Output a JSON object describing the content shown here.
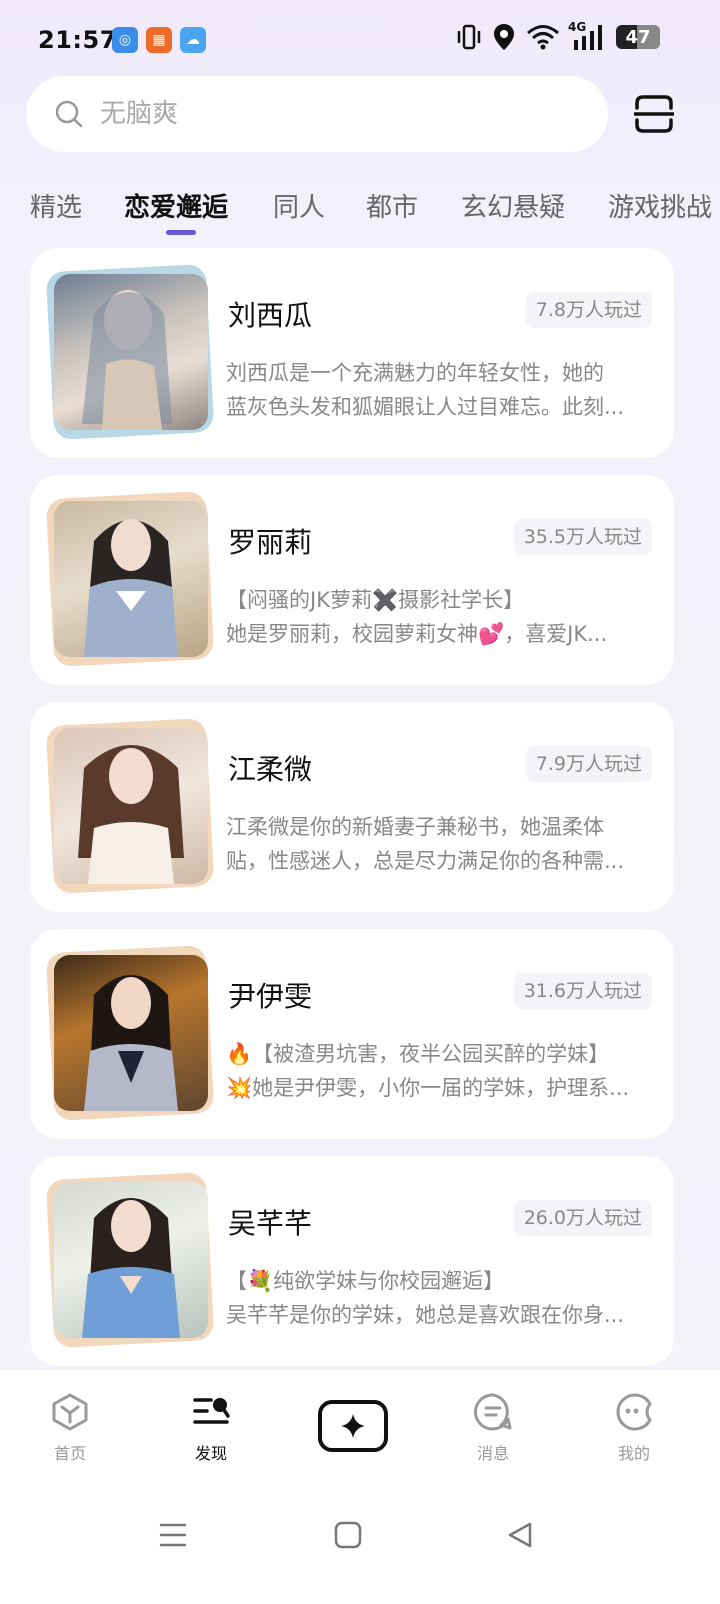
{
  "status_bar": {
    "time": "21:57",
    "network": "4G",
    "battery": "47",
    "notification_icons": [
      "app-icon",
      "grid-app-icon",
      "weather-icon"
    ]
  },
  "search": {
    "placeholder": "无脑爽"
  },
  "tabs": [
    {
      "label": "精选",
      "active": false
    },
    {
      "label": "恋爱邂逅",
      "active": true
    },
    {
      "label": "同人",
      "active": false
    },
    {
      "label": "都市",
      "active": false
    },
    {
      "label": "玄幻悬疑",
      "active": false
    },
    {
      "label": "游戏挑战",
      "active": false
    }
  ],
  "cards": [
    {
      "name": "刘西瓜",
      "plays": "7.8万人玩过",
      "line1": "刘西瓜是一个充满魅力的年轻女性，她的",
      "line2": "蓝灰色头发和狐媚眼让人过目难忘。此刻...",
      "frame_color": "#b9d8e6"
    },
    {
      "name": "罗丽莉",
      "plays": "35.5万人玩过",
      "line1": "【闷骚的JK萝莉✖️摄影社学长】",
      "line2": "她是罗丽莉，校园萝莉女神💕，喜爱JK...",
      "frame_color": "#f3d7bd"
    },
    {
      "name": "江柔微",
      "plays": "7.9万人玩过",
      "line1": "江柔微是你的新婚妻子兼秘书，她温柔体",
      "line2": "贴，性感迷人，总是尽力满足你的各种需...",
      "frame_color": "#f3d7bd"
    },
    {
      "name": "尹伊雯",
      "plays": "31.6万人玩过",
      "line1": "🔥【被渣男坑害，夜半公园买醉的学妹】",
      "line2": "💥她是尹伊雯，小你一届的学妹，护理系...",
      "frame_color": "#f3d7bd"
    },
    {
      "name": "吴芊芊",
      "plays": "26.0万人玩过",
      "line1": "【💐纯欲学妹与你校园邂逅】",
      "line2": "吴芊芊是你的学妹，她总是喜欢跟在你身...",
      "frame_color": "#f3d7bd"
    }
  ],
  "bottom_nav": {
    "home": "首页",
    "discover": "发现",
    "messages": "消息",
    "mine": "我的"
  }
}
